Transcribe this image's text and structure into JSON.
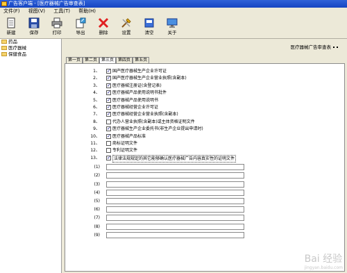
{
  "window": {
    "title": "广告客户端 - [医疗器械广告审查表]"
  },
  "menu": {
    "items": [
      "文件(F)",
      "视图(V)",
      "工具(T)",
      "帮助(H)"
    ]
  },
  "toolbar": {
    "new": "新建",
    "save": "保存",
    "print": "打印",
    "export": "导出",
    "delete": "删除",
    "settings": "设置",
    "clear": "清空",
    "about": "关于"
  },
  "tree": {
    "items": [
      "药品",
      "医疗器械",
      "保健食品"
    ]
  },
  "doc": {
    "title": "医疗器械广告审查表"
  },
  "tabs": [
    "第一页",
    "第二页",
    "第三页",
    "第四页",
    "第五页"
  ],
  "checklist": [
    {
      "num": "1、",
      "label": "国产医疗器械生产企业许可证",
      "checked": true
    },
    {
      "num": "2、",
      "label": "国产医疗器械生产企业营业执照(含副本)",
      "checked": true
    },
    {
      "num": "3、",
      "label": "医疗器械注册证(含登记表)",
      "checked": true
    },
    {
      "num": "4、",
      "label": "医疗器械产品使用说明书批件",
      "checked": true
    },
    {
      "num": "5、",
      "label": "医疗器械产品使用说明书",
      "checked": true
    },
    {
      "num": "6、",
      "label": "医疗器械经营企业许可证",
      "checked": true
    },
    {
      "num": "7、",
      "label": "医疗器械经营企业营业执照(含副本)",
      "checked": true
    },
    {
      "num": "8、",
      "label": "代办人营业执照(含副本)或主体资格证明文件",
      "checked": false
    },
    {
      "num": "9、",
      "label": "医疗器械生产企业委托书(非生产企业提出申请时)",
      "checked": true
    },
    {
      "num": "10、",
      "label": "医疗器械产品标准",
      "checked": true
    },
    {
      "num": "11、",
      "label": "商标证明文件",
      "checked": false
    },
    {
      "num": "12、",
      "label": "专利证明文件",
      "checked": false
    },
    {
      "num": "13、",
      "label": "法律法规规定的其它能够确认医疗器械广告内容真实性的证明文件",
      "checked": true
    }
  ],
  "extra_fields": [
    {
      "num": "(1)",
      "value": ""
    },
    {
      "num": "(2)",
      "value": ""
    },
    {
      "num": "(3)",
      "value": ""
    },
    {
      "num": "(4)",
      "value": ""
    },
    {
      "num": "(5)",
      "value": ""
    },
    {
      "num": "(6)",
      "value": ""
    },
    {
      "num": "(7)",
      "value": ""
    },
    {
      "num": "(8)",
      "value": ""
    },
    {
      "num": "(9)",
      "value": ""
    }
  ],
  "watermark": {
    "text": "Bai 经验",
    "url": "jingyan.baidu.com"
  }
}
